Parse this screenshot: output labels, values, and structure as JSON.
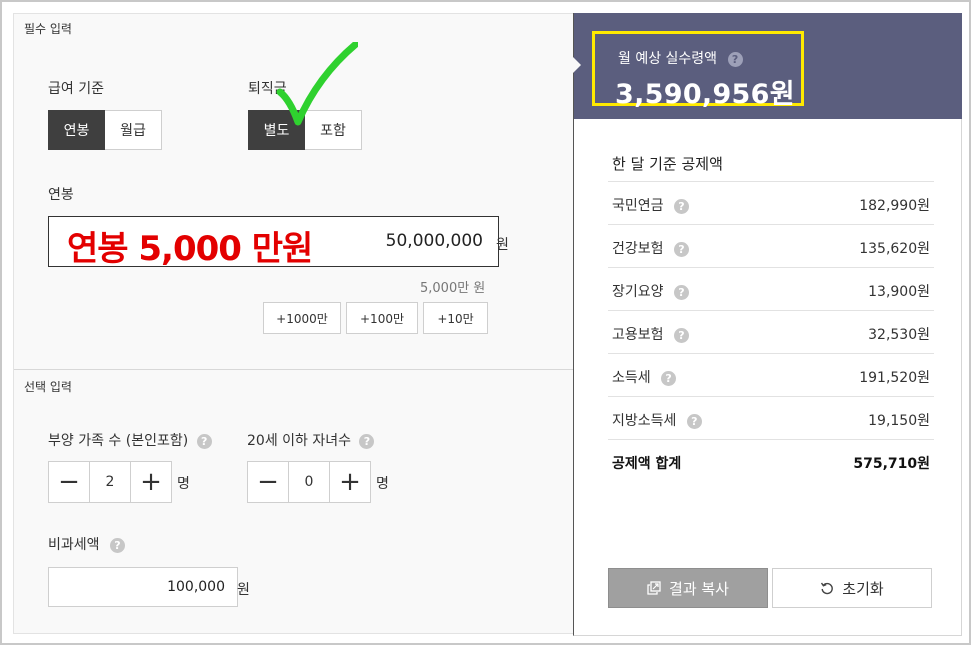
{
  "left": {
    "required_title": "필수 입력",
    "pay_basis": {
      "label": "급여 기준",
      "options": [
        "연봉",
        "월급"
      ],
      "selected": "연봉"
    },
    "severance": {
      "label": "퇴직금",
      "options": [
        "별도",
        "포함"
      ],
      "selected": "별도"
    },
    "salary": {
      "label": "연봉",
      "overlay_text": "연봉 5,000 만원",
      "value": "50,000,000",
      "unit": "원",
      "hint": "5,000만 원",
      "add_buttons": [
        "+1000만",
        "+100만",
        "+10만"
      ]
    },
    "optional_title": "선택 입력",
    "dependents": {
      "label": "부양 가족 수 (본인포함)",
      "value": "2",
      "unit": "명"
    },
    "children": {
      "label": "20세 이하 자녀수",
      "value": "0",
      "unit": "명"
    },
    "nontaxable": {
      "label": "비과세액",
      "value": "100,000",
      "unit": "원"
    }
  },
  "right": {
    "header_label": "월 예상 실수령액",
    "header_value": "3,590,956원",
    "deduction_title": "한 달 기준 공제액",
    "deductions": [
      {
        "name": "국민연금",
        "value": "182,990원"
      },
      {
        "name": "건강보험",
        "value": "135,620원"
      },
      {
        "name": "장기요양",
        "value": "13,900원"
      },
      {
        "name": "고용보험",
        "value": "32,530원"
      },
      {
        "name": "소득세",
        "value": "191,520원"
      },
      {
        "name": "지방소득세",
        "value": "19,150원"
      }
    ],
    "total": {
      "name": "공제액 합계",
      "value": "575,710원"
    },
    "copy_button": "결과 복사",
    "reset_button": "초기화"
  },
  "help_glyph": "?",
  "icons": [
    "help-icon",
    "checkmark-icon",
    "copy-icon",
    "reset-icon",
    "minus-icon",
    "plus-icon"
  ],
  "colors": {
    "header_bg": "#5b5e7e",
    "highlight_border": "#ffea00",
    "overlay_text": "#e30000",
    "checkmark": "#2fd12f",
    "active_toggle": "#3f3f3f"
  }
}
